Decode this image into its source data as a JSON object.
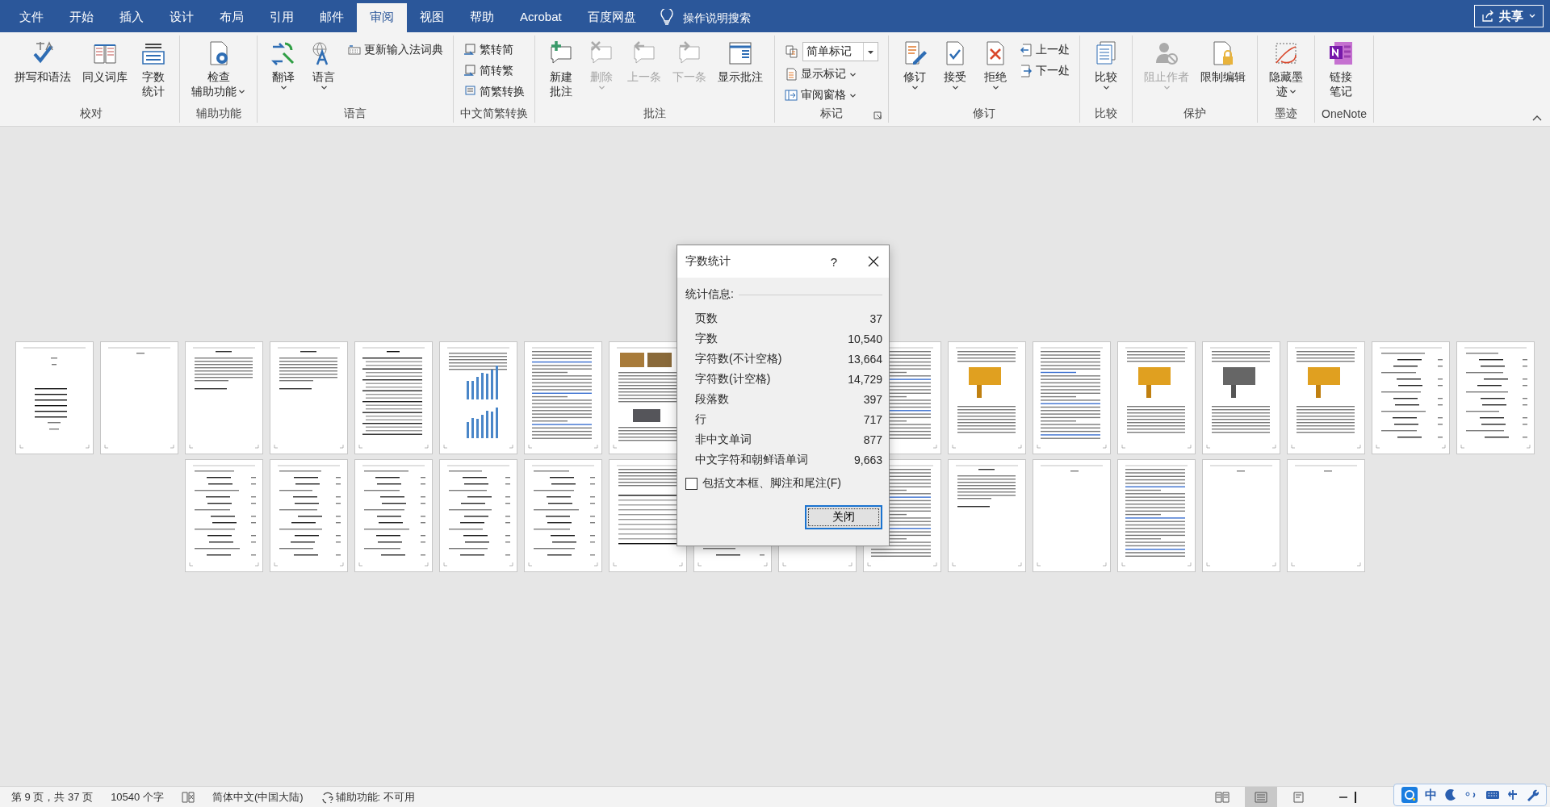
{
  "tabs": [
    {
      "label": "文件",
      "selected": false
    },
    {
      "label": "开始",
      "selected": false
    },
    {
      "label": "插入",
      "selected": false
    },
    {
      "label": "设计",
      "selected": false
    },
    {
      "label": "布局",
      "selected": false
    },
    {
      "label": "引用",
      "selected": false
    },
    {
      "label": "邮件",
      "selected": false
    },
    {
      "label": "审阅",
      "selected": true
    },
    {
      "label": "视图",
      "selected": false
    },
    {
      "label": "帮助",
      "selected": false
    },
    {
      "label": "Acrobat",
      "selected": false
    },
    {
      "label": "百度网盘",
      "selected": false
    }
  ],
  "tell_me": "操作说明搜索",
  "share": "共享",
  "ribbon": [
    {
      "label": "校对",
      "launcher": false,
      "items": [
        {
          "kind": "large",
          "lines": [
            "拼写和语法"
          ],
          "dropdown": false,
          "disabled": false
        },
        {
          "kind": "large",
          "lines": [
            "同义词库"
          ],
          "dropdown": false,
          "disabled": false
        },
        {
          "kind": "large",
          "lines": [
            "字数",
            "统计"
          ],
          "dropdown": false,
          "disabled": false
        }
      ]
    },
    {
      "label": "辅助功能",
      "launcher": false,
      "items": [
        {
          "kind": "large",
          "lines": [
            "检查",
            "辅助功能"
          ],
          "dropdown": true,
          "disabled": false
        }
      ]
    },
    {
      "label": "语言",
      "launcher": false,
      "items": [
        {
          "kind": "large",
          "lines": [
            "翻译"
          ],
          "dropdown": true,
          "disabled": false
        },
        {
          "kind": "large",
          "lines": [
            "语言"
          ],
          "dropdown": true,
          "disabled": false
        },
        {
          "kind": "small",
          "label": "更新输入法词典",
          "dropdown": false,
          "disabled": false
        }
      ]
    },
    {
      "label": "中文简繁转换",
      "launcher": false,
      "items": [
        {
          "kind": "small",
          "label": "繁转简",
          "dropdown": false,
          "disabled": false
        },
        {
          "kind": "small",
          "label": "简转繁",
          "dropdown": false,
          "disabled": false
        },
        {
          "kind": "small",
          "label": "简繁转换",
          "dropdown": false,
          "disabled": false
        }
      ]
    },
    {
      "label": "批注",
      "launcher": false,
      "items": [
        {
          "kind": "large",
          "lines": [
            "新建",
            "批注"
          ],
          "dropdown": false,
          "disabled": false
        },
        {
          "kind": "large",
          "lines": [
            "删除"
          ],
          "dropdown": true,
          "disabled": true
        },
        {
          "kind": "large",
          "lines": [
            "上一条"
          ],
          "dropdown": false,
          "disabled": true
        },
        {
          "kind": "large",
          "lines": [
            "下一条"
          ],
          "dropdown": false,
          "disabled": true
        },
        {
          "kind": "large",
          "lines": [
            "显示批注"
          ],
          "dropdown": false,
          "disabled": false
        }
      ]
    },
    {
      "label": "标记",
      "launcher": true,
      "items": [
        {
          "kind": "combo",
          "value": "简单标记"
        },
        {
          "kind": "small",
          "label": "显示标记",
          "dropdown": true,
          "disabled": false
        },
        {
          "kind": "small",
          "label": "审阅窗格",
          "dropdown": true,
          "disabled": false
        }
      ]
    },
    {
      "label": "修订",
      "launcher": false,
      "items": [
        {
          "kind": "large",
          "lines": [
            "修订"
          ],
          "dropdown": true,
          "disabled": false
        },
        {
          "kind": "large",
          "lines": [
            "接受"
          ],
          "dropdown": true,
          "disabled": false
        },
        {
          "kind": "large",
          "lines": [
            "拒绝"
          ],
          "dropdown": true,
          "disabled": false
        },
        {
          "kind": "small",
          "label": "上一处",
          "dropdown": false,
          "disabled": false
        },
        {
          "kind": "small",
          "label": "下一处",
          "dropdown": false,
          "disabled": false
        }
      ]
    },
    {
      "label": "比较",
      "launcher": false,
      "items": [
        {
          "kind": "large",
          "lines": [
            "比较"
          ],
          "dropdown": true,
          "disabled": false
        }
      ]
    },
    {
      "label": "保护",
      "launcher": false,
      "items": [
        {
          "kind": "large",
          "lines": [
            "阻止作者"
          ],
          "dropdown": true,
          "disabled": true
        },
        {
          "kind": "large",
          "lines": [
            "限制编辑"
          ],
          "dropdown": false,
          "disabled": false
        }
      ]
    },
    {
      "label": "墨迹",
      "launcher": false,
      "items": [
        {
          "kind": "large",
          "lines": [
            "隐藏墨",
            "迹"
          ],
          "dropdown": true,
          "disabled": false
        }
      ]
    },
    {
      "label": "OneNote",
      "launcher": false,
      "items": [
        {
          "kind": "large",
          "lines": [
            "链接",
            "笔记"
          ],
          "dropdown": false,
          "disabled": false
        }
      ]
    }
  ],
  "page_rows": [
    {
      "pages": [
        {
          "kind": "cover"
        },
        {
          "kind": "blank"
        },
        {
          "kind": "abstract"
        },
        {
          "kind": "abstract"
        },
        {
          "kind": "toc"
        },
        {
          "kind": "chart"
        },
        {
          "kind": "text"
        },
        {
          "kind": "photos"
        },
        {
          "kind": "covered"
        },
        {
          "kind": "covered"
        },
        {
          "kind": "text"
        },
        {
          "kind": "figure"
        },
        {
          "kind": "text"
        },
        {
          "kind": "figure"
        },
        {
          "kind": "figure"
        },
        {
          "kind": "figure"
        },
        {
          "kind": "formula"
        },
        {
          "kind": "formula"
        }
      ]
    },
    {
      "pages": [
        {
          "kind": "formula"
        },
        {
          "kind": "formula"
        },
        {
          "kind": "formula"
        },
        {
          "kind": "formula"
        },
        {
          "kind": "formula"
        },
        {
          "kind": "table"
        },
        {
          "kind": "formula"
        },
        {
          "kind": "blank"
        },
        {
          "kind": "text"
        },
        {
          "kind": "abstract"
        },
        {
          "kind": "blank"
        },
        {
          "kind": "text"
        },
        {
          "kind": "blank"
        },
        {
          "kind": "blank"
        }
      ]
    }
  ],
  "dialog": {
    "title": "字数统计",
    "help": "?",
    "section": "统计信息:",
    "stats": [
      {
        "label": "页数",
        "value": "37"
      },
      {
        "label": "字数",
        "value": "10,540"
      },
      {
        "label": "字符数(不计空格)",
        "value": "13,664"
      },
      {
        "label": "字符数(计空格)",
        "value": "14,729"
      },
      {
        "label": "段落数",
        "value": "397"
      },
      {
        "label": "行",
        "value": "717"
      },
      {
        "label": "非中文单词",
        "value": "877"
      },
      {
        "label": "中文字符和朝鲜语单词",
        "value": "9,663"
      }
    ],
    "checkbox": {
      "label": "包括文本框、脚注和尾注(F)",
      "checked": false
    },
    "button": "关闭"
  },
  "status_bar": {
    "page": "第 9 页，共 37 页",
    "words": "10540 个字",
    "language": "简体中文(中国大陆)",
    "accessibility": "辅助功能: 不可用",
    "views": [
      {
        "selected": false
      },
      {
        "selected": true
      },
      {
        "selected": false
      }
    ]
  },
  "ime": {
    "mode": "中"
  }
}
